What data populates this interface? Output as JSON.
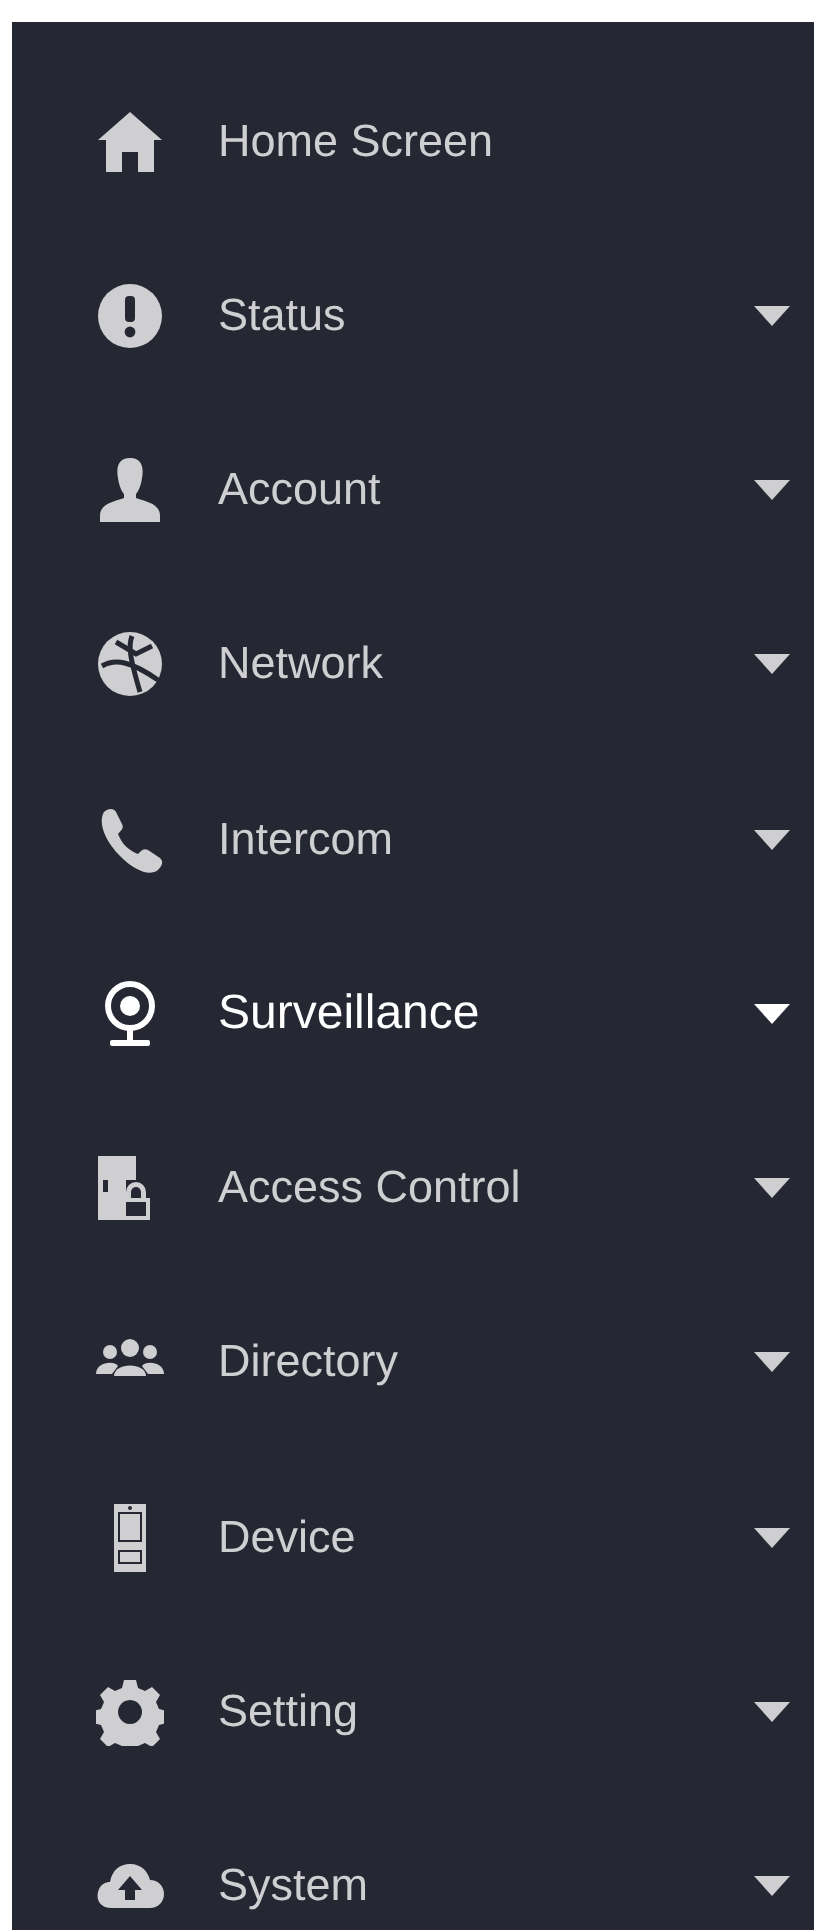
{
  "sidebar": {
    "items": [
      {
        "label": "Home Screen",
        "kind": "link",
        "selected": false
      },
      {
        "label": "Status",
        "kind": "submenu",
        "selected": false
      },
      {
        "label": "Account",
        "kind": "submenu",
        "selected": false
      },
      {
        "label": "Network",
        "kind": "submenu",
        "selected": false
      },
      {
        "label": "Intercom",
        "kind": "submenu",
        "selected": false
      },
      {
        "label": "Surveillance",
        "kind": "submenu",
        "selected": true
      },
      {
        "label": "Access Control",
        "kind": "submenu",
        "selected": false
      },
      {
        "label": "Directory",
        "kind": "submenu",
        "selected": false
      },
      {
        "label": "Device",
        "kind": "submenu",
        "selected": false
      },
      {
        "label": "Setting",
        "kind": "submenu",
        "selected": false
      },
      {
        "label": "System",
        "kind": "submenu",
        "selected": false
      }
    ]
  }
}
